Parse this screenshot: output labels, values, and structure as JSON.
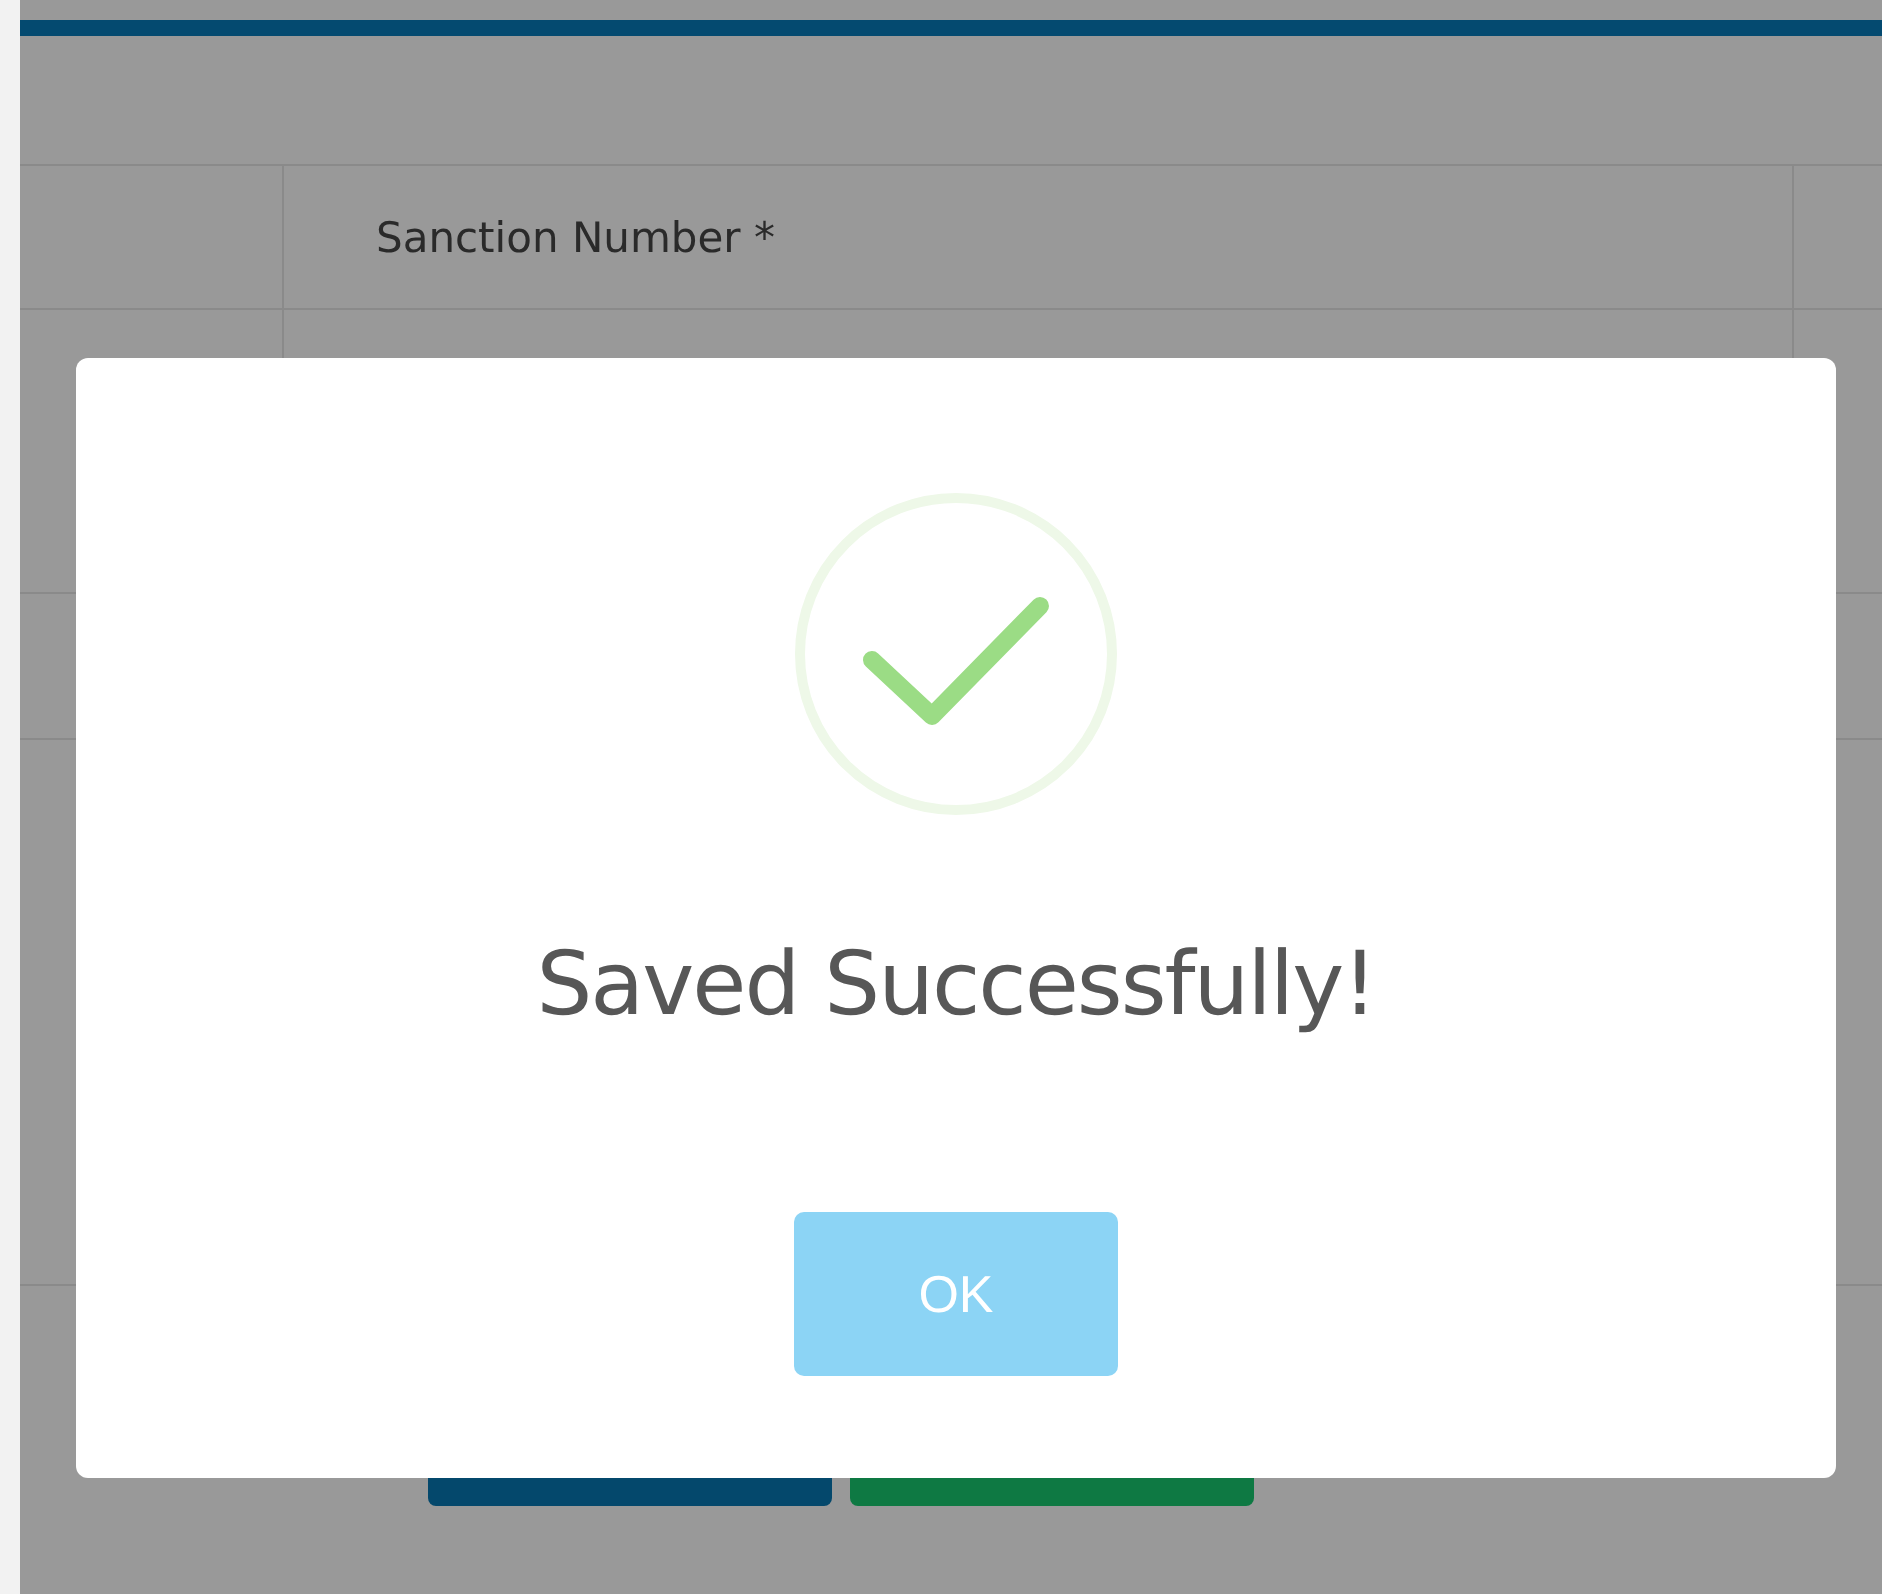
{
  "table": {
    "columns": [
      {},
      {
        "label": "Sanction Number *"
      }
    ]
  },
  "modal": {
    "message": "Saved Successfully!",
    "button": "OK"
  }
}
